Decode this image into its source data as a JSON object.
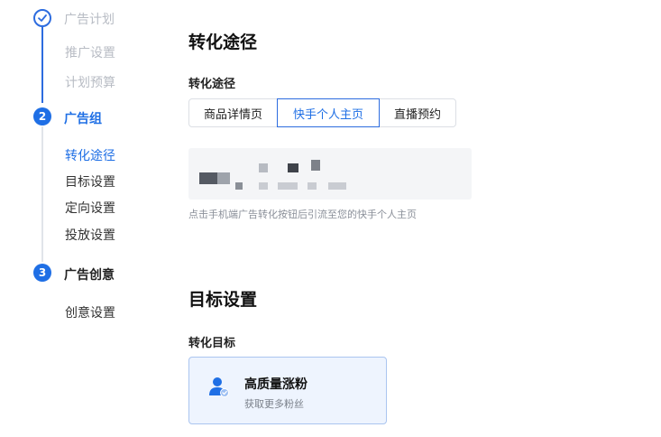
{
  "stepper": {
    "step1": {
      "title": "广告计划",
      "items": [
        "推广设置",
        "计划预算"
      ]
    },
    "step2": {
      "number": "2",
      "title": "广告组",
      "items": [
        "转化途径",
        "目标设置",
        "定向设置",
        "投放设置"
      ]
    },
    "step3": {
      "number": "3",
      "title": "广告创意",
      "items": [
        "创意设置"
      ]
    }
  },
  "conversion": {
    "section_title": "转化途径",
    "label": "转化途径",
    "options": [
      "商品详情页",
      "快手个人主页",
      "直播预约"
    ],
    "selected": "快手个人主页",
    "hint": "点击手机端广告转化按钮后引流至您的快手个人主页"
  },
  "goal": {
    "section_title": "目标设置",
    "label": "转化目标",
    "card_title": "高质量涨粉",
    "card_subtitle": "获取更多粉丝"
  },
  "icons": {
    "done": "check-circle-icon",
    "goal": "user-check-icon"
  },
  "colors": {
    "accent": "#1f6fe5",
    "muted": "#b8bcc4"
  }
}
